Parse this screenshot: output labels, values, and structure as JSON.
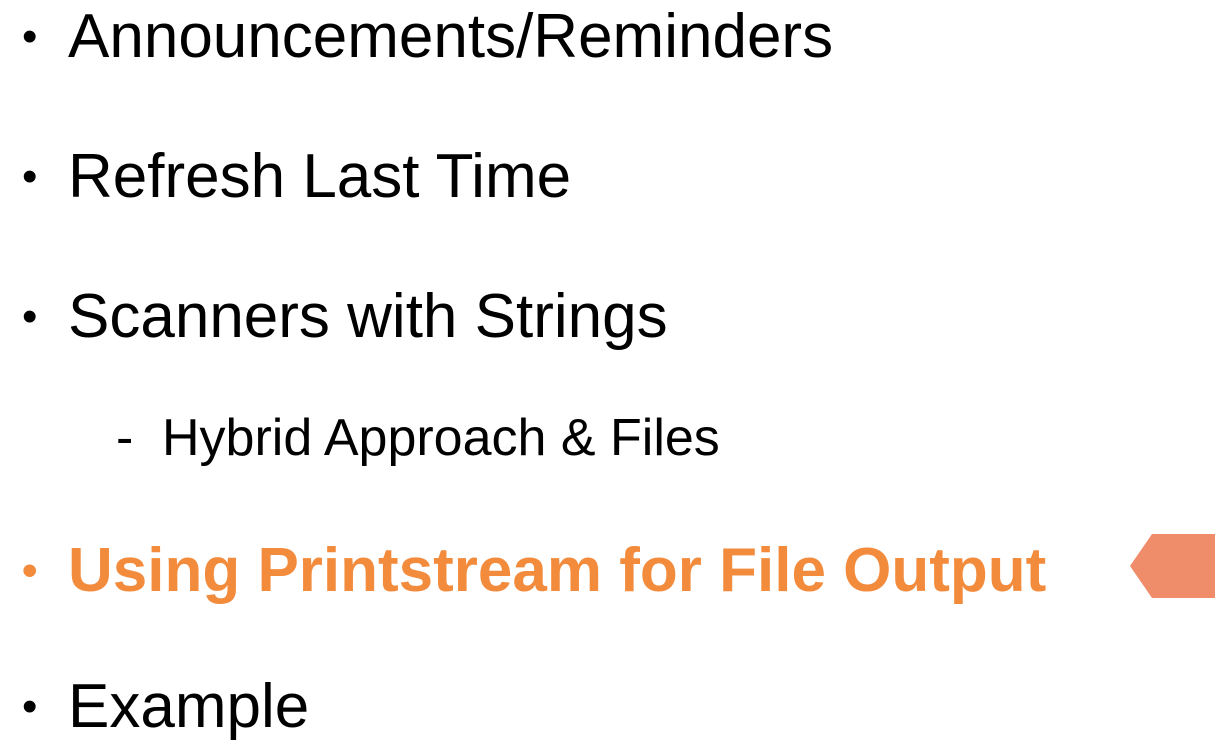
{
  "slide": {
    "items": [
      {
        "bullet": "•",
        "label": "Announcements/Reminders"
      },
      {
        "bullet": "•",
        "label": "Refresh Last Time"
      },
      {
        "bullet": "•",
        "label": "Scanners with Strings"
      },
      {
        "bullet": "-",
        "label": "Hybrid Approach & Files"
      },
      {
        "bullet": "•",
        "label": "Using Printstream for File Output"
      },
      {
        "bullet": "•",
        "label": "Example"
      }
    ]
  },
  "colors": {
    "text": "#000000",
    "highlight": "#F38B3C",
    "pointer": "#EF8C6A"
  },
  "icons": {
    "current_item_pointer": "arrow-left-pointer-icon"
  }
}
